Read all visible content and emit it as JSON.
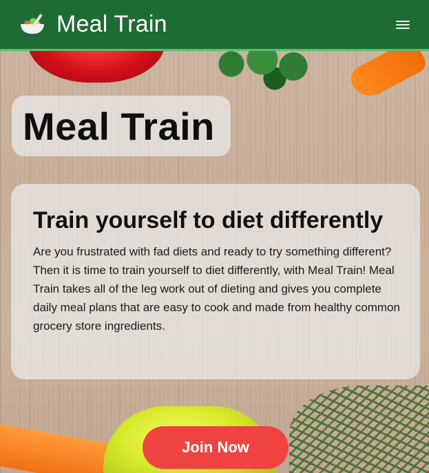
{
  "header": {
    "brand": "Meal Train",
    "logo_icon": "salad-bowl-icon",
    "menu_icon": "hamburger-menu-icon"
  },
  "hero": {
    "title": "Meal Train"
  },
  "card": {
    "heading": "Train yourself to diet differently",
    "body": "Are you frustrated with fad diets and ready to try something different? Then it is time to train yourself to diet differently, with Meal Train! Meal Train takes all of the leg work out of dieting and gives you complete daily meal plans that are easy to cook and made from healthy common grocery store ingredients."
  },
  "cta": {
    "label": "Join Now"
  },
  "colors": {
    "header_bg": "#1f6b34",
    "header_accent": "#55c26a",
    "cta_bg": "#ef4342"
  }
}
